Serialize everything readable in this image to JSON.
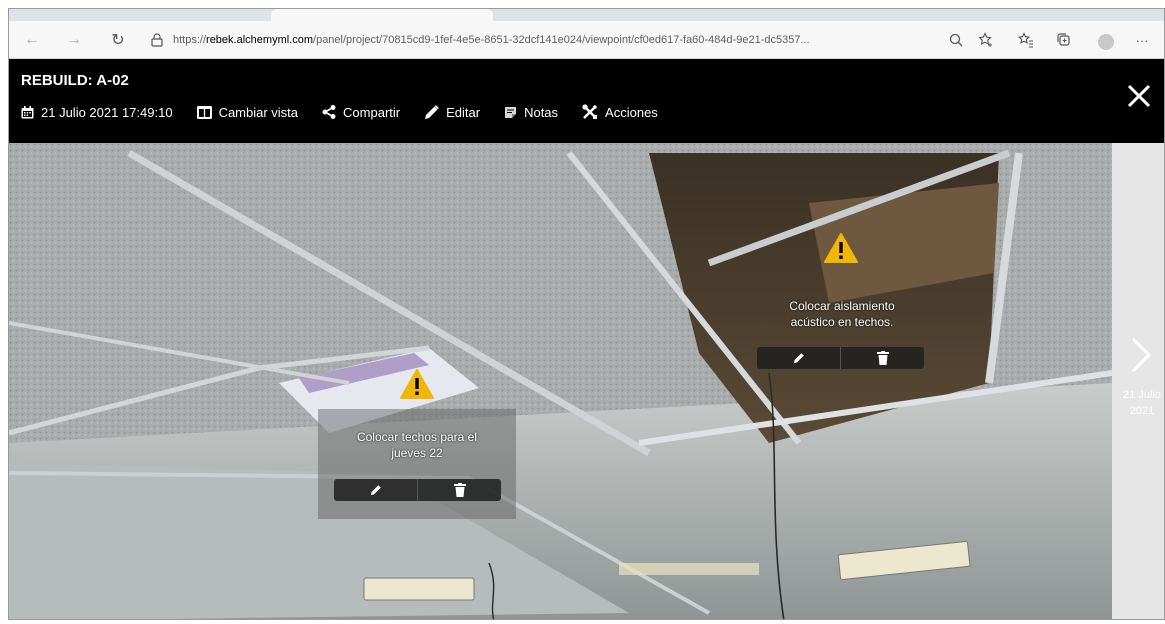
{
  "browser": {
    "url_prefix": "https://",
    "url_domain": "rebek.alchemyml.com",
    "url_path": "/panel/project/70815cd9-1fef-4e5e-8651-32dcf141e024/viewpoint/cf0ed617-fa60-484d-9e21-dc5357...",
    "more_label": "···"
  },
  "header": {
    "title": "REBUILD: A-02",
    "toolbar": {
      "date": "21 Julio 2021 17:49:10",
      "change_view": "Cambiar vista",
      "share": "Compartir",
      "edit": "Editar",
      "notes": "Notas",
      "actions": "Acciones"
    }
  },
  "viewer": {
    "next_date_line1": "21 Julio",
    "next_date_line2": "2021",
    "notes": [
      {
        "text_line1": "Colocar aislamiento",
        "text_line2": "acústico en techos."
      },
      {
        "text_line1": "Colocar techos para el",
        "text_line2": "jueves 22"
      }
    ]
  },
  "colors": {
    "header_bg": "#000000",
    "warning": "#f2b705",
    "chrome_bg": "#f7f7f7"
  }
}
